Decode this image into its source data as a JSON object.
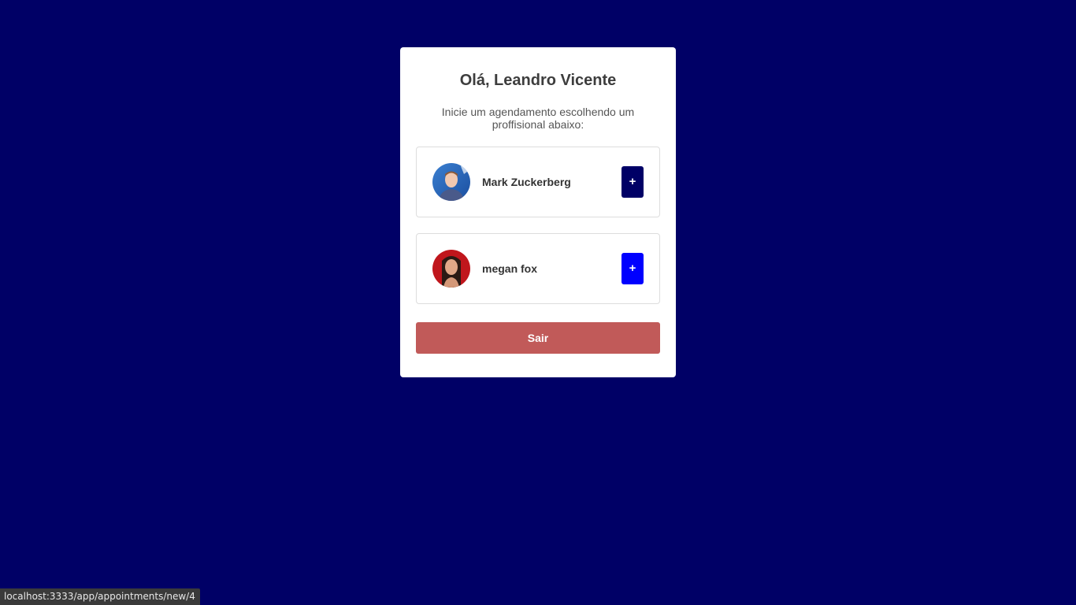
{
  "page": {
    "background_color": "#000066"
  },
  "card": {
    "greeting": "Olá, Leandro Vicente",
    "subtitle": "Inicie um agendamento escolhendo um proffisional abaixo:"
  },
  "providers": [
    {
      "name": "Mark Zuckerberg",
      "add_label": "+",
      "button_color": "#000066",
      "avatar_icon": "avatar-photo"
    },
    {
      "name": "megan fox",
      "add_label": "+",
      "button_color": "#0000ff",
      "avatar_icon": "avatar-photo"
    }
  ],
  "logout": {
    "label": "Sair",
    "color": "#c15a59"
  },
  "statusbar": {
    "url": "localhost:3333/app/appointments/new/4"
  }
}
